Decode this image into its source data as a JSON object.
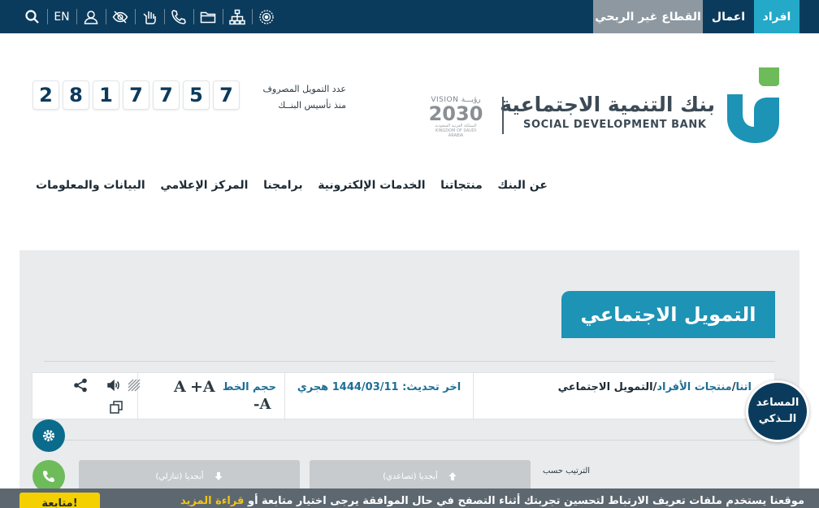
{
  "topbar": {
    "segments": {
      "individuals": "افراد",
      "business": "اعمال",
      "nonprofit": "القطاع غير الربحي"
    },
    "lang": "EN",
    "icons": [
      "search-icon",
      "user-icon",
      "eye-slash-icon",
      "sign-language-icon",
      "phone-icon",
      "folder-icon",
      "sitemap-icon",
      "settings-badge-icon"
    ]
  },
  "header": {
    "bank_name_ar": "بنك التنمية الاجتماعية",
    "bank_name_en": "SOCIAL DEVELOPMENT BANK",
    "vision": {
      "top": "VISION رؤيـــة",
      "year": "2030",
      "sub": "المملكة العربية السعودية KINGDOM OF SAUDI ARABIA"
    },
    "fund_label_line1": "عدد التمويل المصروف",
    "fund_label_line2": "منذ تأسيس البنــك",
    "counter_digits": [
      "2",
      "8",
      "1",
      "7",
      "7",
      "5",
      "7"
    ]
  },
  "nav": {
    "items": [
      {
        "label": "عن البنك"
      },
      {
        "label": "منتجاتنا"
      },
      {
        "label": "الخدمات الإلكترونية"
      },
      {
        "label": "برامجنا"
      },
      {
        "label": "المركز الإعلامي"
      },
      {
        "label": "البيانات والمعلومات"
      }
    ]
  },
  "page": {
    "title": "التمويل الاجتماعي",
    "breadcrumb": {
      "first": "اتنا",
      "second": "منتجات الأفراد",
      "third": "التمويل الاجتماعي"
    },
    "updated": "اخر تحديث: 1444/03/11 هجري",
    "font_size_label": "حجم الخط",
    "font_plus": "+A",
    "font_big": "A",
    "font_minus": "-A",
    "sort_label": "الترتيب حسب",
    "sort_asc": "أبجديا (تصاعدي)",
    "sort_desc": "أبجديا (تنازلي)"
  },
  "assistant": {
    "line1": "المساعد",
    "line2": "الــذكي"
  },
  "cookie": {
    "text": "موقعنا يستخدم ملفات تعريف الارتباط لتحسين تجربتك أثناء التصفح في حال الموافقة يرجى اختيار متابعة أو",
    "more": "قراءة المزيد",
    "button": "متابعة!"
  },
  "colors": {
    "navy": "#0b3b5c",
    "teal": "#25a9c9",
    "title_blue": "#1d93b6",
    "gray_segment": "#8d98a1",
    "cookie_yellow": "#f4d000",
    "green": "#6dbb59"
  }
}
